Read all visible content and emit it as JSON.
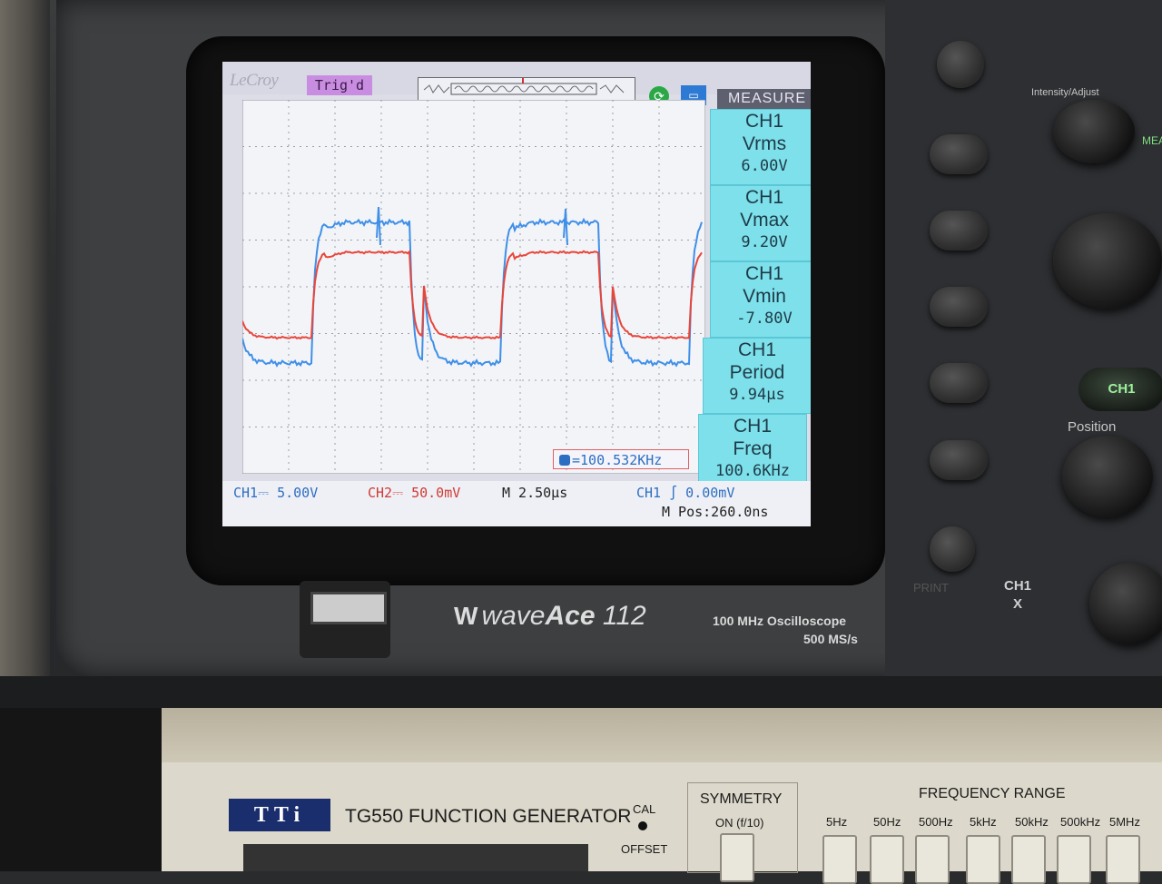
{
  "screen": {
    "brand_logo": "LeCroy",
    "trigger_status": "Trig'd",
    "menu_title": "MEASURE",
    "counter_readout": "=100.532KHz",
    "measurements": [
      {
        "channel": "CH1",
        "name": "Vrms",
        "value": "6.00V"
      },
      {
        "channel": "CH1",
        "name": "Vmax",
        "value": "9.20V"
      },
      {
        "channel": "CH1",
        "name": "Vmin",
        "value": "-7.80V"
      },
      {
        "channel": "CH1",
        "name": "Period",
        "value": "9.94μs"
      },
      {
        "channel": "CH1",
        "name": "Freq",
        "value": "100.6KHz"
      }
    ],
    "status": {
      "ch1_scale": "CH1⎓ 5.00V",
      "ch2_scale": "CH2⎓ 50.0mV",
      "timebase": "M 2.50μs",
      "trigger": "CH1 ∫ 0.00mV",
      "position": "M Pos:260.0ns"
    },
    "trace_colors": {
      "ch1": "#3f8fe8",
      "ch2": "#e8463a"
    }
  },
  "scope": {
    "model_prefix": "W",
    "model_wave": "wave",
    "model_ace": "Ace",
    "model_number": "112",
    "spec_bandwidth": "100 MHz Oscilloscope",
    "spec_rate": "500 MS/s",
    "panel_labels": {
      "intensity": "Intensity/Adjust",
      "position": "Position",
      "ch1_button": "CH1",
      "ch1_x": "CH1",
      "x_label": "X",
      "print": "PRINT",
      "measure": "MEA"
    }
  },
  "function_generator": {
    "brand": "TTi",
    "model": "TG550  FUNCTION GENERATOR",
    "cal": "CAL",
    "offset": "OFFSET",
    "symmetry": "SYMMETRY",
    "symmetry_option": "ON (f/10)",
    "frequency_range": "FREQUENCY RANGE",
    "ranges": [
      "5Hz",
      "50Hz",
      "500Hz",
      "5kHz",
      "50kHz",
      "500kHz",
      "5MHz"
    ]
  }
}
